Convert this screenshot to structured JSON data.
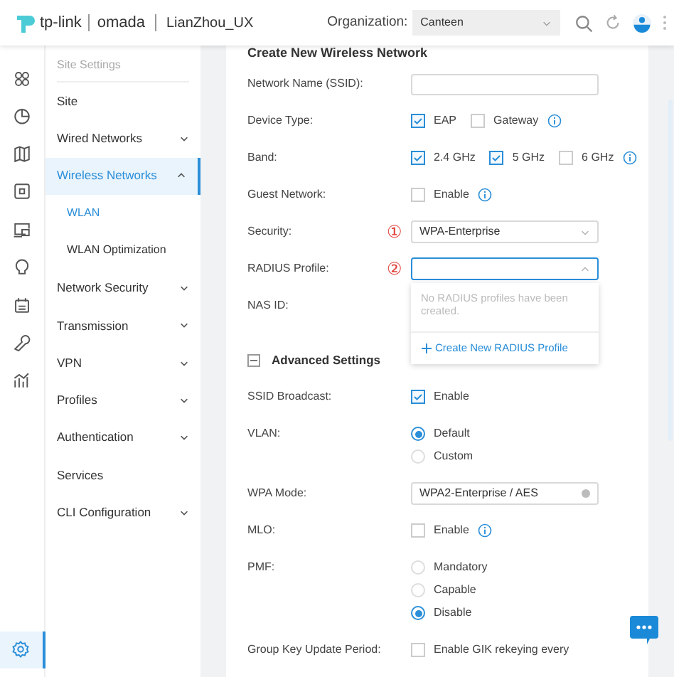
{
  "header": {
    "brand": "tp-link",
    "product": "omada",
    "site": "LianZhou_UX",
    "org_label": "Organization:",
    "org_value": "Canteen"
  },
  "rail": [
    {
      "kind": "grid",
      "selected": false
    },
    {
      "kind": "chart",
      "selected": false
    },
    {
      "kind": "map",
      "selected": false
    },
    {
      "kind": "device",
      "selected": false
    },
    {
      "kind": "screen",
      "selected": false
    },
    {
      "kind": "bulb",
      "selected": false
    },
    {
      "kind": "calendar",
      "selected": false
    },
    {
      "kind": "wrench",
      "selected": false
    },
    {
      "kind": "bars",
      "selected": false
    },
    {
      "kind": "gear",
      "selected": true
    }
  ],
  "sidebar": {
    "heading": "Site Settings",
    "items": [
      {
        "label": "Site",
        "selected": false
      },
      {
        "label": "Wired Networks",
        "selected": false,
        "expanded": false
      },
      {
        "label": "Wireless Networks",
        "selected": true,
        "expanded": true,
        "children": [
          {
            "label": "WLAN",
            "selected": true
          },
          {
            "label": "WLAN Optimization",
            "selected": false
          }
        ]
      },
      {
        "label": "Network Security",
        "selected": false,
        "expanded": false
      },
      {
        "label": "Transmission",
        "selected": false,
        "expanded": false
      },
      {
        "label": "VPN",
        "selected": false,
        "expanded": false
      },
      {
        "label": "Profiles",
        "selected": false,
        "expanded": false
      },
      {
        "label": "Authentication",
        "selected": false,
        "expanded": false
      },
      {
        "label": "Services",
        "selected": false
      },
      {
        "label": "CLI Configuration",
        "selected": false,
        "expanded": false
      }
    ]
  },
  "form": {
    "title": "Create New Wireless Network",
    "rows": [
      {
        "kind": "input",
        "label": "Network Name (SSID):"
      },
      {
        "kind": "checks",
        "label": "Device Type:",
        "info": true,
        "options": [
          {
            "label": "EAP",
            "checked": true
          },
          {
            "label": "Gateway",
            "checked": false
          }
        ]
      },
      {
        "kind": "checks",
        "label": "Band:",
        "info": true,
        "options": [
          {
            "label": "2.4 GHz",
            "checked": true
          },
          {
            "label": "5 GHz",
            "checked": true
          },
          {
            "label": "6 GHz",
            "checked": false
          }
        ]
      },
      {
        "kind": "checks",
        "label": "Guest Network:",
        "info": true,
        "options": [
          {
            "label": "Enable",
            "checked": false
          }
        ]
      },
      {
        "kind": "select",
        "label": "Security:",
        "marker": "①",
        "value": "WPA-Enterprise",
        "open": false,
        "locked": false
      },
      {
        "kind": "select",
        "label": "RADIUS Profile:",
        "marker": "②",
        "open": true,
        "locked": false,
        "empty_text": "No RADIUS profiles have been created.",
        "action": "Create New RADIUS Profile"
      },
      {
        "kind": "label",
        "label": "NAS ID:"
      },
      {
        "kind": "section",
        "label": "Advanced Settings",
        "expanded": true
      },
      {
        "kind": "checks",
        "label": "SSID Broadcast:",
        "info": false,
        "options": [
          {
            "label": "Enable",
            "checked": true
          }
        ]
      },
      {
        "kind": "radios",
        "label": "VLAN:",
        "options": [
          {
            "label": "Default",
            "selected": true
          },
          {
            "label": "Custom",
            "selected": false
          }
        ]
      },
      {
        "kind": "select",
        "label": "WPA Mode:",
        "value": "WPA2-Enterprise / AES",
        "open": false,
        "locked": true
      },
      {
        "kind": "checks",
        "label": "MLO:",
        "info": true,
        "options": [
          {
            "label": "Enable",
            "checked": false
          }
        ]
      },
      {
        "kind": "radios",
        "label": "PMF:",
        "options": [
          {
            "label": "Mandatory",
            "selected": false
          },
          {
            "label": "Capable",
            "selected": false
          },
          {
            "label": "Disable",
            "selected": true
          }
        ]
      },
      {
        "kind": "checks",
        "label": "Group Key Update Period:",
        "info": false,
        "options": [
          {
            "label": "Enable GIK rekeying every",
            "checked": false
          }
        ]
      }
    ]
  }
}
